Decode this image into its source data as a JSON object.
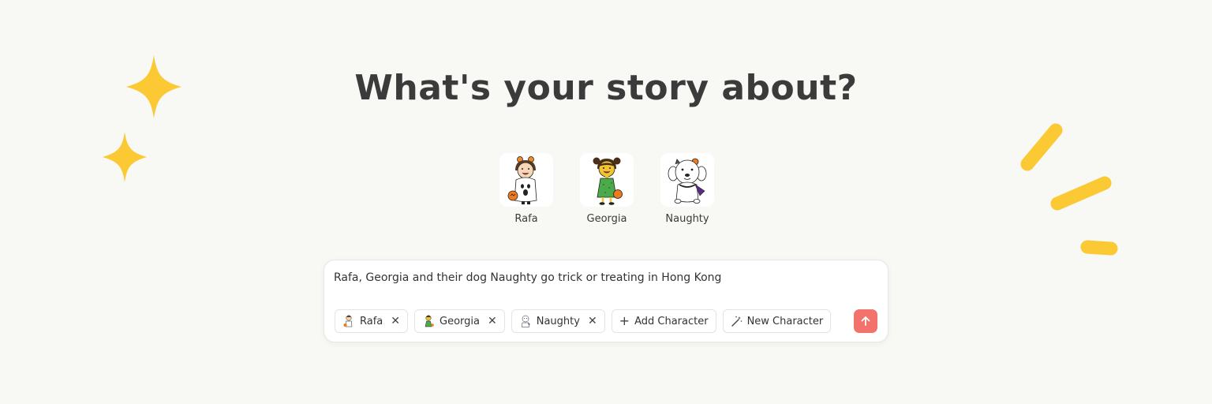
{
  "heading": "What's your story about?",
  "characters": [
    {
      "name": "Rafa",
      "icon": "rafa-ghost-costume-avatar-icon"
    },
    {
      "name": "Georgia",
      "icon": "georgia-green-dress-avatar-icon"
    },
    {
      "name": "Naughty",
      "icon": "naughty-white-dog-avatar-icon"
    }
  ],
  "composer": {
    "prompt_value": "Rafa, Georgia and their dog Naughty go trick or treating in Hong Kong",
    "chips": [
      {
        "label": "Rafa",
        "icon": "rafa-mini-icon"
      },
      {
        "label": "Georgia",
        "icon": "georgia-mini-icon"
      },
      {
        "label": "Naughty",
        "icon": "naughty-mini-icon"
      }
    ],
    "add_character_label": "Add Character",
    "new_character_label": "New Character",
    "send_icon": "arrow-up-icon"
  },
  "colors": {
    "background": "#f8f8f5",
    "sparkle": "#fbc934",
    "send_button": "#f2736b",
    "text": "#3b3b3b"
  }
}
